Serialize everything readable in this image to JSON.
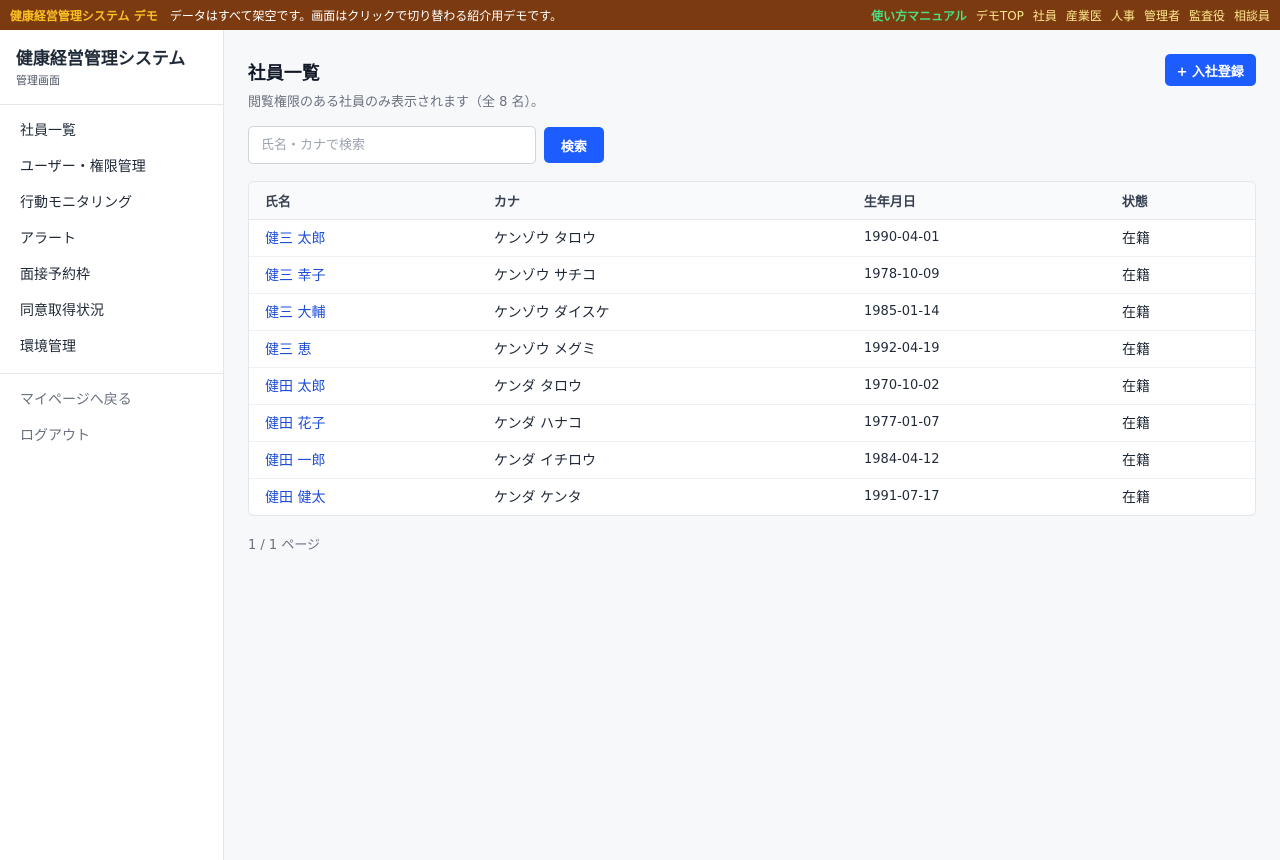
{
  "demo_bar": {
    "brand": "健康経営管理システム デモ",
    "note": "データはすべて架空です。画面はクリックで切り替わる紹介用デモです。",
    "manual": "使い方マニュアル",
    "links": [
      "デモTOP",
      "社員",
      "産業医",
      "人事",
      "管理者",
      "監査役",
      "相談員"
    ]
  },
  "sidebar": {
    "title": "健康経営管理システム",
    "subtitle": "管理画面",
    "items": [
      "社員一覧",
      "ユーザー・権限管理",
      "行動モニタリング",
      "アラート",
      "面接予約枠",
      "同意取得状況",
      "環境管理"
    ],
    "footer": [
      "マイページへ戻る",
      "ログアウト"
    ]
  },
  "page": {
    "title": "社員一覧",
    "description": "閲覧権限のある社員のみ表示されます（全 8 名）。",
    "add_button": "+ 入社登録",
    "search_placeholder": "氏名・カナで検索",
    "search_button": "検索",
    "pager": "1 / 1 ページ"
  },
  "table": {
    "columns": [
      "氏名",
      "カナ",
      "生年月日",
      "状態"
    ],
    "rows": [
      {
        "name": "健三 太郎",
        "kana": "ケンゾウ タロウ",
        "birth": "1990-04-01",
        "status": "在籍"
      },
      {
        "name": "健三 幸子",
        "kana": "ケンゾウ サチコ",
        "birth": "1978-10-09",
        "status": "在籍"
      },
      {
        "name": "健三 大輔",
        "kana": "ケンゾウ ダイスケ",
        "birth": "1985-01-14",
        "status": "在籍"
      },
      {
        "name": "健三 恵",
        "kana": "ケンゾウ メグミ",
        "birth": "1992-04-19",
        "status": "在籍"
      },
      {
        "name": "健田 太郎",
        "kana": "ケンダ タロウ",
        "birth": "1970-10-02",
        "status": "在籍"
      },
      {
        "name": "健田 花子",
        "kana": "ケンダ ハナコ",
        "birth": "1977-01-07",
        "status": "在籍"
      },
      {
        "name": "健田 一郎",
        "kana": "ケンダ イチロウ",
        "birth": "1984-04-12",
        "status": "在籍"
      },
      {
        "name": "健田 健太",
        "kana": "ケンダ ケンタ",
        "birth": "1991-07-17",
        "status": "在籍"
      }
    ]
  },
  "colors": {
    "demo_bar_bg": "#7c3a10",
    "accent": "#1d5cff",
    "link": "#1d4ed8",
    "manual_link": "#4ade80",
    "brand_label": "#fbbf24"
  }
}
